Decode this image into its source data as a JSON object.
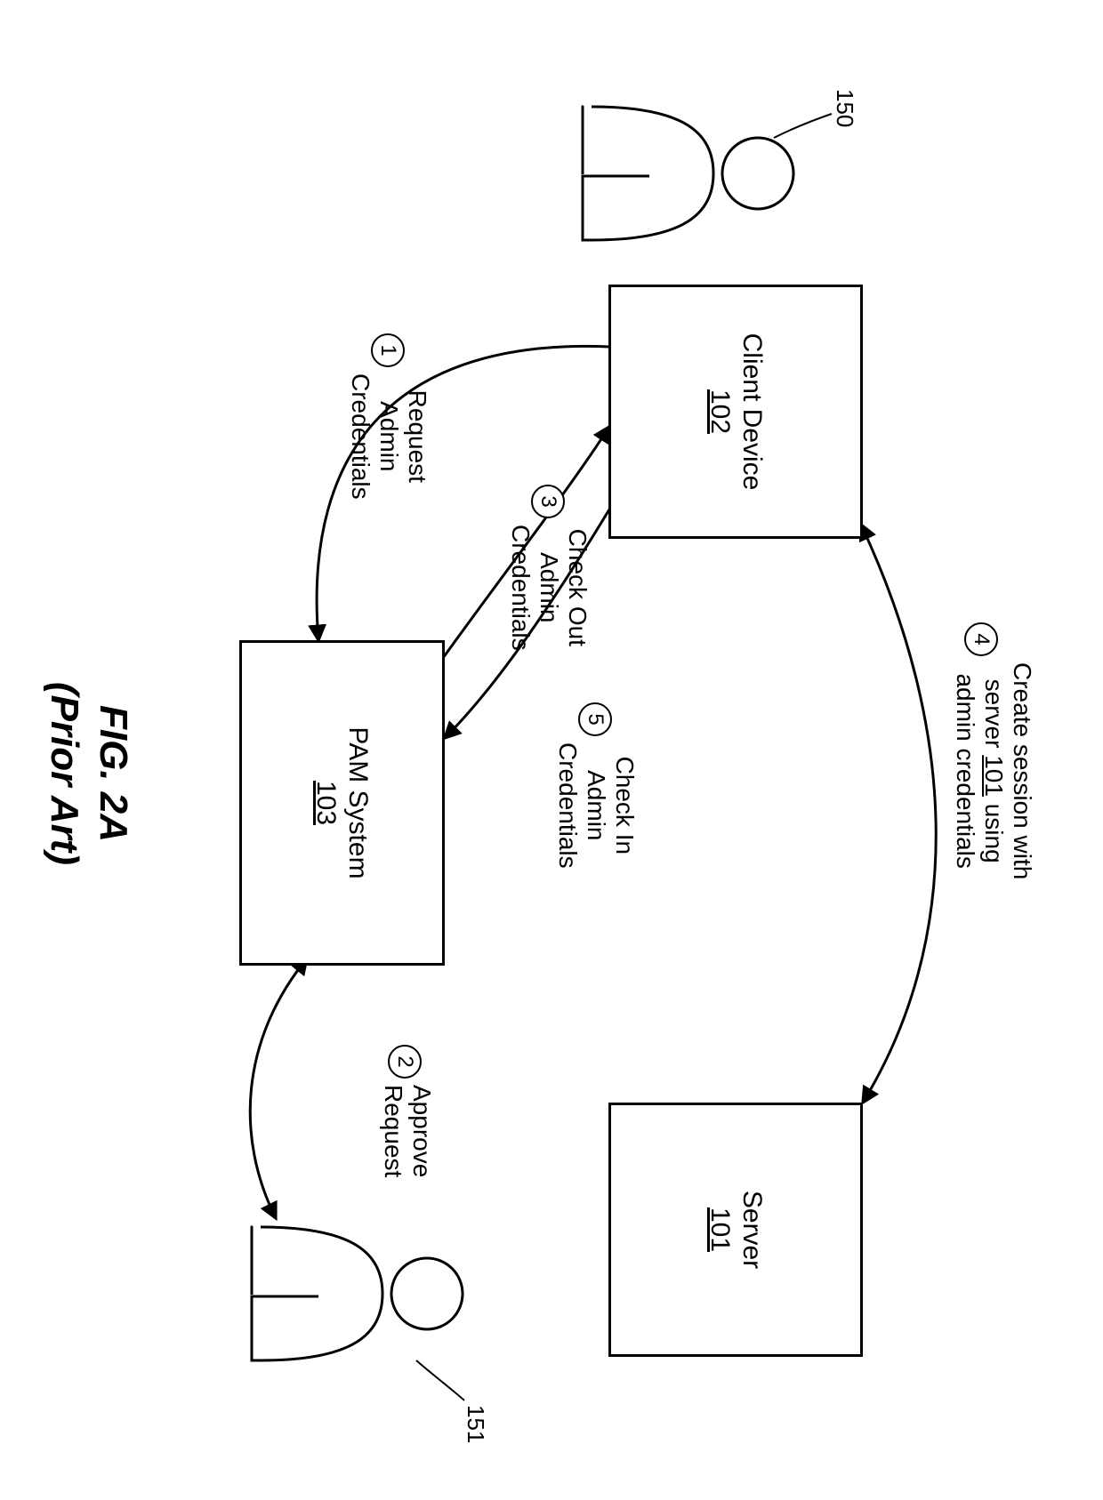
{
  "nodes": {
    "client": {
      "title": "Client Device",
      "id": "102"
    },
    "server": {
      "title": "Server",
      "id": "101"
    },
    "pam": {
      "title": "PAM System",
      "id": "103"
    }
  },
  "users": {
    "left": {
      "label": "150"
    },
    "right": {
      "label": "151"
    }
  },
  "steps": {
    "s1": {
      "n": "1",
      "text": "Request\nAdmin\nCredentials"
    },
    "s2": {
      "n": "2",
      "text": "Approve\nRequest"
    },
    "s3": {
      "n": "3",
      "text": "Check Out\nAdmin\nCredentials"
    },
    "s4": {
      "n": "4",
      "pre": "Create session with\nserver ",
      "linked": "101",
      "post": " using\nadmin credentials"
    },
    "s5": {
      "n": "5",
      "text": "Check In\nAdmin\nCredentials"
    }
  },
  "caption": {
    "line1": "FIG. 2A",
    "line2": "(Prior Art)"
  }
}
